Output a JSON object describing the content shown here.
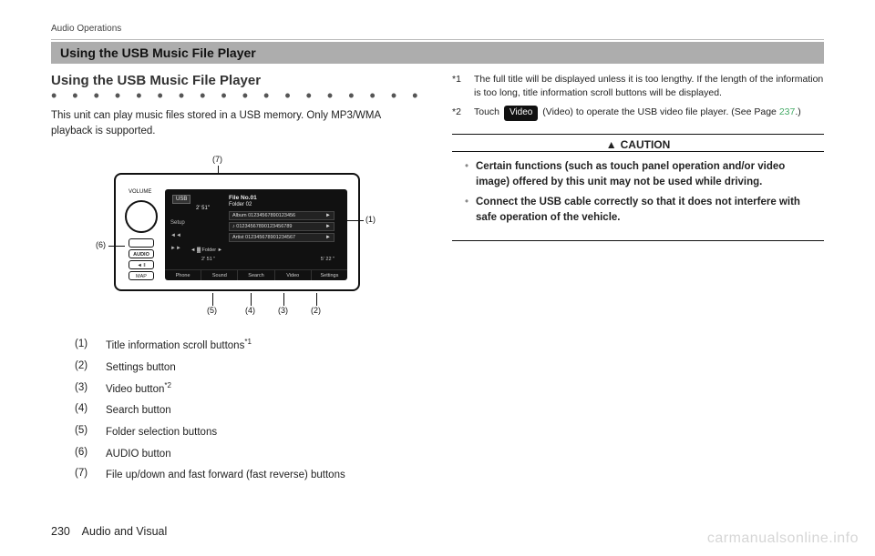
{
  "running_head": "Audio Operations",
  "heading_bar": "Using the USB Music File Player",
  "subheading": "Using the USB Music File Player",
  "intro": "This unit can play music files stored in a USB memory. Only MP3/WMA playback is supported.",
  "diagram": {
    "knob_label": "VOLUME",
    "small_buttons": {
      "b1": "",
      "b2": "AUDIO",
      "b3": "◄ ‖",
      "b4": "MAP"
    },
    "screen": {
      "usb_badge": "USB",
      "elapsed": "2' 51\"",
      "header_line1": "File No.01",
      "header_line2": "Folder 02",
      "left_icons": [
        "Setup",
        "",
        ""
      ],
      "rows": [
        "Album 01234567890123456",
        "♪  01234567890123456789",
        "Artist 012345678901234567"
      ],
      "folder": "◄    ▓  Folder    ►",
      "time_left": "2' 51 \"",
      "time_right": "5' 22 \"",
      "bottom": [
        "Phone",
        "Sound",
        "Search",
        "Video",
        "Settings"
      ]
    },
    "callouts": {
      "c7": "(7)",
      "c1": "(1)",
      "c6": "(6)",
      "c5": "(5)",
      "c4": "(4)",
      "c3": "(3)",
      "c2": "(2)"
    }
  },
  "legend": [
    {
      "n": "(1)",
      "t": "Title information scroll buttons",
      "sup": "*1"
    },
    {
      "n": "(2)",
      "t": "Settings button",
      "sup": ""
    },
    {
      "n": "(3)",
      "t": "Video button",
      "sup": "*2"
    },
    {
      "n": "(4)",
      "t": "Search button",
      "sup": ""
    },
    {
      "n": "(5)",
      "t": "Folder selection buttons",
      "sup": ""
    },
    {
      "n": "(6)",
      "t": "AUDIO button",
      "sup": ""
    },
    {
      "n": "(7)",
      "t": "File up/down and fast forward (fast reverse) buttons",
      "sup": ""
    }
  ],
  "footnotes": {
    "f1": "The full title will be displayed unless it is too lengthy. If the length of the information is too long, title information scroll buttons will be displayed.",
    "f2_pre": "Touch ",
    "f2_chip": "Video",
    "f2_mid": " (Video) to operate the USB video file player. (See Page ",
    "f2_page": "237",
    "f2_post": ".)"
  },
  "caution": {
    "title": "CAUTION",
    "items": [
      "Certain functions (such as touch panel operation and/or video image) offered by this unit may not be used while driving.",
      "Connect the USB cable correctly so that it does not interfere with safe operation of the vehicle."
    ]
  },
  "footer": {
    "page": "230",
    "section": "Audio and Visual"
  },
  "watermark": "carmanualsonline.info"
}
